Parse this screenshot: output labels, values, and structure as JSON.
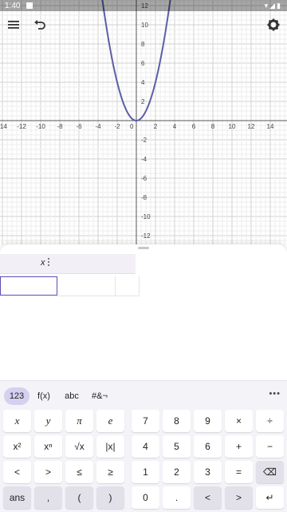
{
  "status": {
    "time": "1:40"
  },
  "toolbar": {
    "menu_icon": "hamburger-menu-icon",
    "undo_icon": "undo-icon",
    "settings_icon": "gear-icon"
  },
  "graph": {
    "function": "y = x^2",
    "curve_color": "#5b5ea6",
    "x_ticks": [
      "-14",
      "-12",
      "-10",
      "-8",
      "-6",
      "-4",
      "-2",
      "2",
      "4",
      "6",
      "8",
      "10",
      "12",
      "14"
    ],
    "y_ticks": [
      "12",
      "10",
      "8",
      "6",
      "4",
      "2",
      "-2",
      "-4",
      "-6",
      "-8",
      "-10",
      "-12"
    ],
    "origin_label": "0"
  },
  "table": {
    "column_header": "x"
  },
  "keyboard": {
    "tabs": [
      "123",
      "f(x)",
      "abc",
      "#&¬"
    ],
    "active_tab": "123",
    "more_label": "•••",
    "rows": [
      [
        "x",
        "y",
        "π",
        "e",
        "7",
        "8",
        "9",
        "×",
        "÷"
      ],
      [
        "x²",
        "xⁿ",
        "√x",
        "|x|",
        "4",
        "5",
        "6",
        "+",
        "−"
      ],
      [
        "<",
        ">",
        "≤",
        "≥",
        "1",
        "2",
        "3",
        "=",
        "⌫"
      ],
      [
        "ans",
        ",",
        "(",
        ")",
        "0",
        ".",
        "<",
        ">",
        "↵"
      ]
    ],
    "ans": "ans",
    "comma": ",",
    "lparen": "(",
    "rparen": ")"
  }
}
